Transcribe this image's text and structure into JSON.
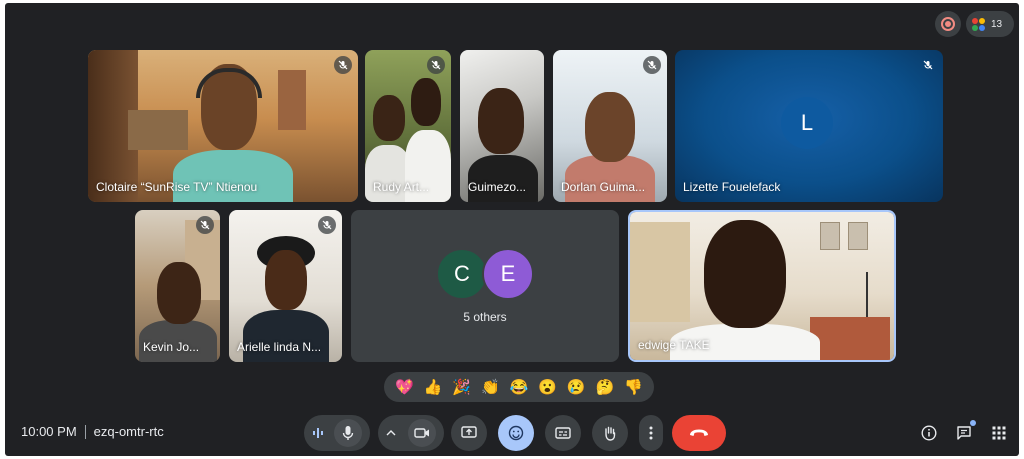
{
  "top_bar": {
    "people_count": "13",
    "people_dot_colors": [
      "#ea4335",
      "#fbbc04",
      "#34a853",
      "#4285f4"
    ]
  },
  "participants": [
    {
      "name": "Clotaire “SunRise TV” Ntienou",
      "muted": true
    },
    {
      "name": "Rudy Art...",
      "muted": true
    },
    {
      "name": "Guimezo...",
      "muted": false
    },
    {
      "name": "Dorlan Guima...",
      "muted": true
    },
    {
      "name": "Lizette Fouelefack",
      "initial": "L",
      "muted": true
    },
    {
      "name": "Kevin Jo...",
      "muted": true
    },
    {
      "name": "Arielle linda N...",
      "muted": true
    },
    {
      "name": "edwige TAKE",
      "muted": false,
      "active_speaker": true
    }
  ],
  "others_tile": {
    "avatars": [
      {
        "initial": "C",
        "color": "#1e5a45"
      },
      {
        "initial": "E",
        "color": "#8e5bd6"
      }
    ],
    "label": "5 others"
  },
  "reactions": [
    "💖",
    "👍",
    "🎉",
    "👏",
    "😂",
    "😮",
    "😢",
    "🤔",
    "👎"
  ],
  "meeting": {
    "time": "10:00 PM",
    "code": "ezq-omtr-rtc"
  },
  "controls": {
    "mic": "microphone-icon",
    "camera": "camera-icon",
    "present": "present-screen-icon",
    "emoji": "emoji-icon",
    "captions": "captions-icon",
    "raise_hand": "raise-hand-icon",
    "more": "more-options-icon",
    "leave": "leave-call-icon"
  },
  "colors": {
    "background": "#202124",
    "tile": "#3c4043",
    "accent": "#a8c7fa",
    "end_call": "#ea4335",
    "lizette_tile": "#0b4f8a"
  }
}
